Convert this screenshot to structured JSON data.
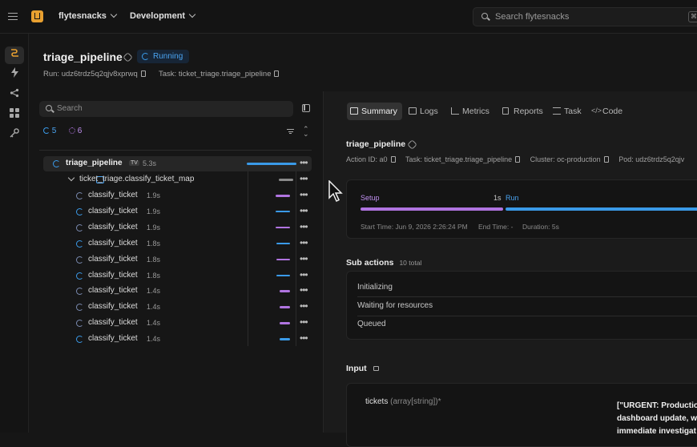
{
  "topbar": {
    "project": "flytesnacks",
    "domain": "Development",
    "search_placeholder": "Search flytesnacks",
    "shortcut": "⌘"
  },
  "rail": {
    "icons": [
      "runs-icon",
      "bolt-icon",
      "share-icon",
      "apps-icon",
      "key-icon"
    ]
  },
  "run": {
    "name": "triage_pipeline",
    "status": "Running",
    "run_label": "Run:",
    "run_id": "udz6trdz5q2qjv8xprwq",
    "task_label": "Task:",
    "task_name": "ticket_triage.triage_pipeline"
  },
  "tree": {
    "search_placeholder": "Search",
    "running_count": "5",
    "queued_count": "6",
    "root": {
      "name": "triage_pipeline",
      "tag": "TV",
      "duration": "5.3s"
    },
    "map": {
      "name": "ticket_triage.classify_ticket_map"
    },
    "children": [
      {
        "name": "classify_ticket",
        "duration": "1.9s",
        "fill": 0.18,
        "color": "#b074e0"
      },
      {
        "name": "classify_ticket",
        "duration": "1.9s",
        "fill": 0.18,
        "color": "#3a9ae8"
      },
      {
        "name": "classify_ticket",
        "duration": "1.9s",
        "fill": 0.18,
        "color": "#b074e0"
      },
      {
        "name": "classify_ticket",
        "duration": "1.8s",
        "fill": 0.17,
        "color": "#3a9ae8"
      },
      {
        "name": "classify_ticket",
        "duration": "1.8s",
        "fill": 0.17,
        "color": "#b074e0"
      },
      {
        "name": "classify_ticket",
        "duration": "1.8s",
        "fill": 0.17,
        "color": "#3a9ae8"
      },
      {
        "name": "classify_ticket",
        "duration": "1.4s",
        "fill": 0.13,
        "color": "#b074e0"
      },
      {
        "name": "classify_ticket",
        "duration": "1.4s",
        "fill": 0.13,
        "color": "#b074e0"
      },
      {
        "name": "classify_ticket",
        "duration": "1.4s",
        "fill": 0.13,
        "color": "#b074e0"
      },
      {
        "name": "classify_ticket",
        "duration": "1.4s",
        "fill": 0.13,
        "color": "#3a9ae8"
      }
    ]
  },
  "tabs": [
    "Summary",
    "Logs",
    "Metrics",
    "Reports",
    "Task",
    "Code"
  ],
  "summary": {
    "name": "triage_pipeline",
    "action_id": "Action ID: a0",
    "task": "Task: ticket_triage.triage_pipeline",
    "cluster": "Cluster: oc-production",
    "pod": "Pod: udz6trdz5q2qjv",
    "timeline": {
      "setup_label": "Setup",
      "setup_duration": "1s",
      "run_label": "Run",
      "start": "Start Time: Jun 9, 2026 2:26:24 PM",
      "end": "End Time: -",
      "duration": "Duration: 5s"
    }
  },
  "sub_actions": {
    "title": "Sub actions",
    "total": "10 total",
    "items": [
      "Initializing",
      "Waiting for resources",
      "Queued"
    ]
  },
  "input": {
    "title": "Input",
    "param_name": "tickets",
    "param_type": "(array[string])*",
    "value_lines": [
      "[\"URGENT: Productio",
      "dashboard update, w",
      "immediate investigat"
    ]
  },
  "colors": {
    "accent": "#e8a030",
    "running": "#3a9ae8",
    "setup": "#b074e0"
  }
}
